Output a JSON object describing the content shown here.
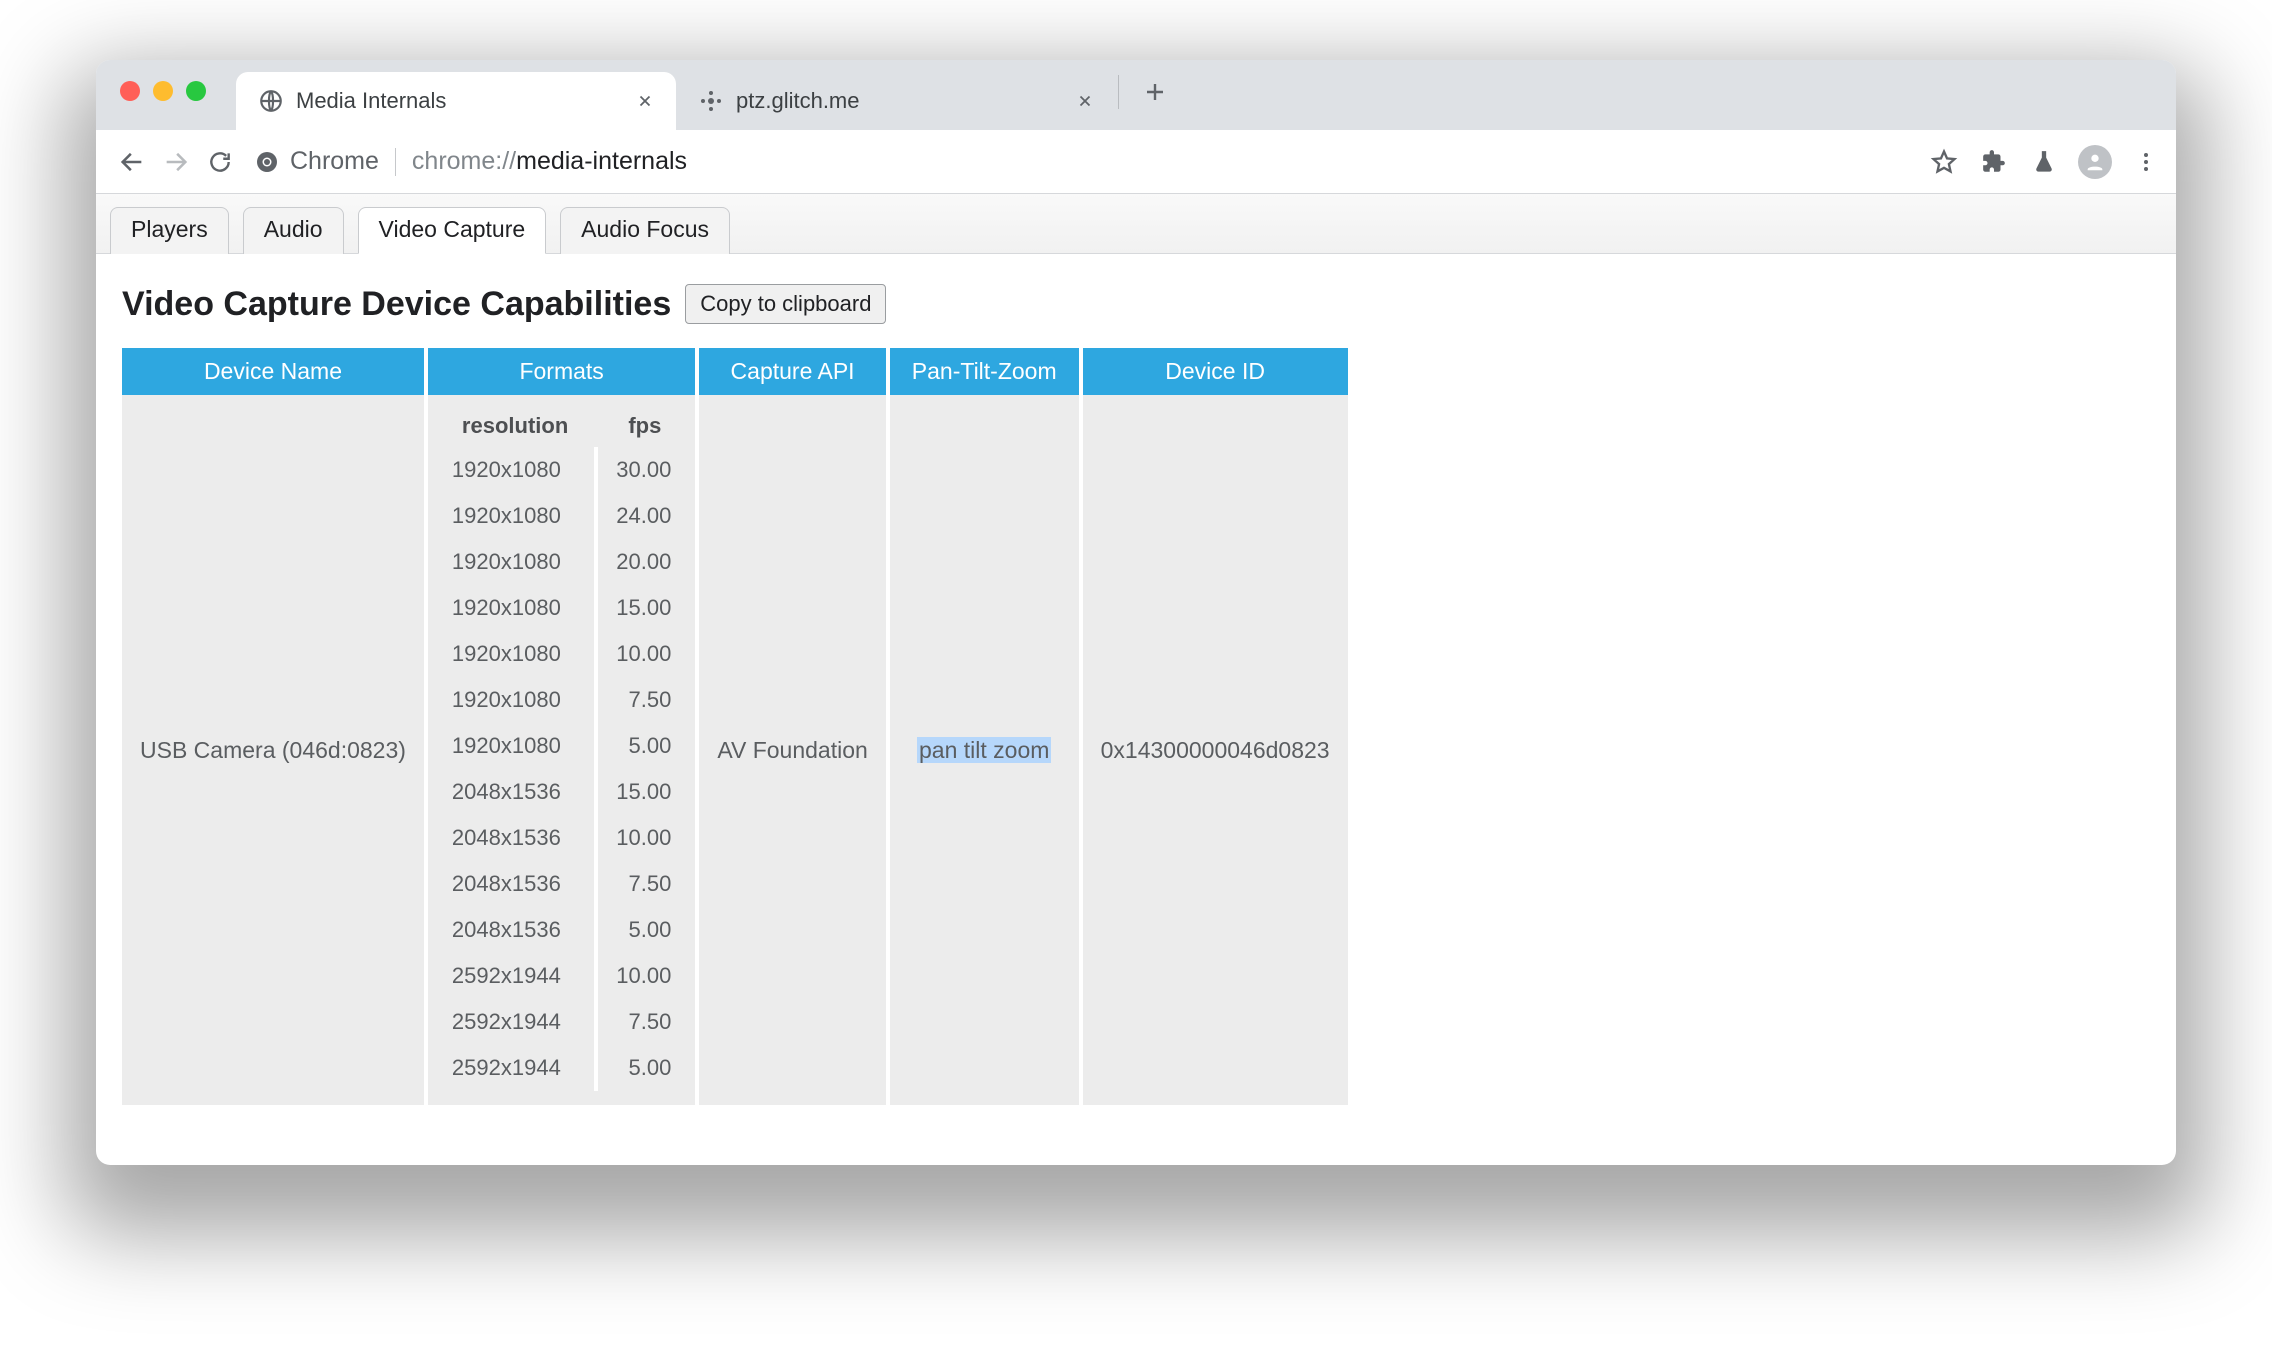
{
  "browser": {
    "tabs": [
      {
        "title": "Media Internals",
        "active": true
      },
      {
        "title": "ptz.glitch.me",
        "active": false
      }
    ],
    "context_label": "Chrome",
    "url_dim": "chrome://",
    "url_rest": "media-internals"
  },
  "internal_tabs": {
    "items": [
      "Players",
      "Audio",
      "Video Capture",
      "Audio Focus"
    ],
    "active_index": 2
  },
  "page": {
    "heading": "Video Capture Device Capabilities",
    "copy_label": "Copy to clipboard"
  },
  "table": {
    "columns": [
      "Device Name",
      "Formats",
      "Capture API",
      "Pan-Tilt-Zoom",
      "Device ID"
    ],
    "formats_columns": {
      "resolution": "resolution",
      "fps": "fps"
    },
    "rows": [
      {
        "device_name": "USB Camera (046d:0823)",
        "capture_api": "AV Foundation",
        "ptz": "pan tilt zoom",
        "device_id": "0x14300000046d0823",
        "formats": [
          {
            "resolution": "1920x1080",
            "fps": "30.00"
          },
          {
            "resolution": "1920x1080",
            "fps": "24.00"
          },
          {
            "resolution": "1920x1080",
            "fps": "20.00"
          },
          {
            "resolution": "1920x1080",
            "fps": "15.00"
          },
          {
            "resolution": "1920x1080",
            "fps": "10.00"
          },
          {
            "resolution": "1920x1080",
            "fps": "7.50"
          },
          {
            "resolution": "1920x1080",
            "fps": "5.00"
          },
          {
            "resolution": "2048x1536",
            "fps": "15.00"
          },
          {
            "resolution": "2048x1536",
            "fps": "10.00"
          },
          {
            "resolution": "2048x1536",
            "fps": "7.50"
          },
          {
            "resolution": "2048x1536",
            "fps": "5.00"
          },
          {
            "resolution": "2592x1944",
            "fps": "10.00"
          },
          {
            "resolution": "2592x1944",
            "fps": "7.50"
          },
          {
            "resolution": "2592x1944",
            "fps": "5.00"
          }
        ]
      }
    ]
  }
}
